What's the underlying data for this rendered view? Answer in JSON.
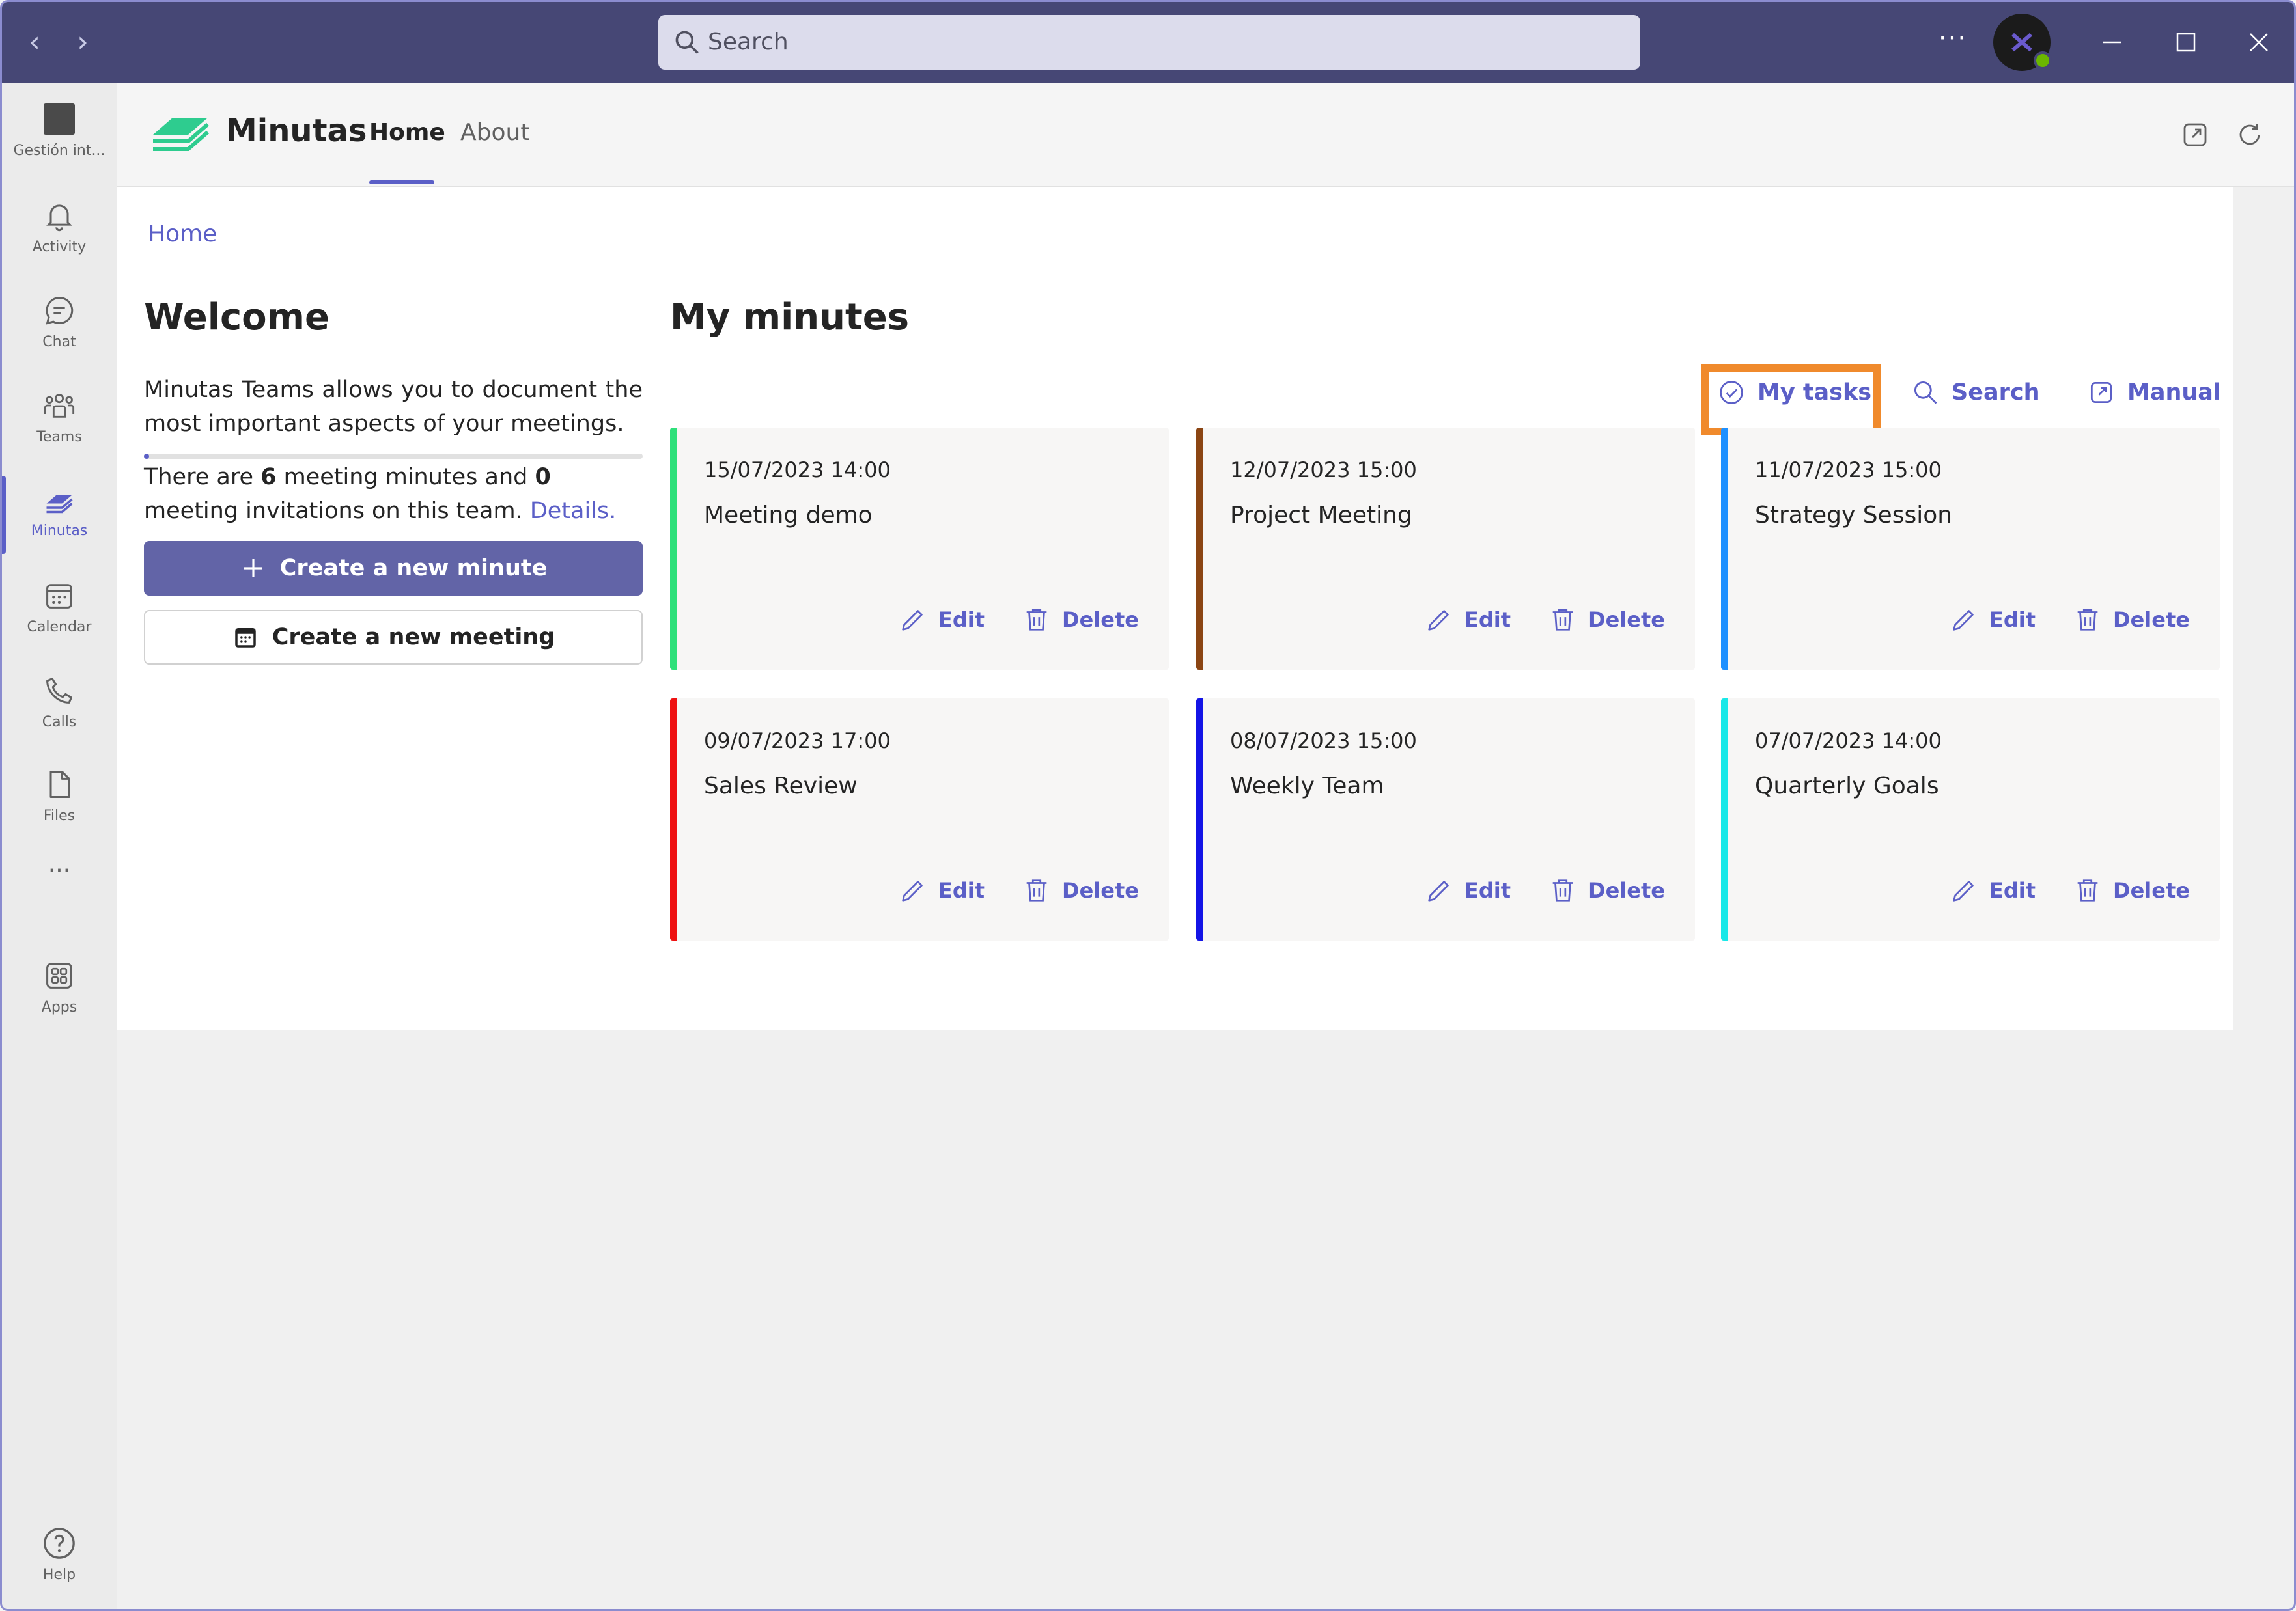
{
  "titlebar": {
    "search_placeholder": "Search",
    "more_label": "···"
  },
  "rail": {
    "items": [
      {
        "label": "Gestión int...",
        "icon": "team-square-icon"
      },
      {
        "label": "Activity",
        "icon": "bell-icon"
      },
      {
        "label": "Chat",
        "icon": "chat-icon"
      },
      {
        "label": "Teams",
        "icon": "teams-icon"
      },
      {
        "label": "Minutas",
        "icon": "minutas-icon"
      },
      {
        "label": "Calendar",
        "icon": "calendar-icon"
      },
      {
        "label": "Calls",
        "icon": "phone-icon"
      },
      {
        "label": "Files",
        "icon": "file-icon"
      },
      {
        "label": "···",
        "icon": "more-icon"
      },
      {
        "label": "Apps",
        "icon": "apps-icon"
      }
    ],
    "help_label": "Help"
  },
  "app": {
    "name": "Minutas",
    "tabs": [
      {
        "label": "Home"
      },
      {
        "label": "About"
      }
    ]
  },
  "content": {
    "breadcrumb": "Home",
    "welcome": {
      "title": "Welcome",
      "description": "Minutas Teams allows you to document the most important aspects of your meetings.",
      "stats_prefix": "There are ",
      "minutes_count": "6",
      "stats_middle": " meeting minutes and ",
      "invitations_count": "0",
      "stats_suffix": " meeting invitations on this team. ",
      "details_link": "Details.",
      "progress_fraction": 0.01,
      "create_minute_label": "Create a new minute",
      "create_meeting_label": "Create a new meeting"
    },
    "minutes": {
      "title": "My minutes",
      "toolbar": {
        "my_tasks": "My tasks",
        "search": "Search",
        "manual": "Manual"
      },
      "cards": [
        {
          "date": "15/07/2023 14:00",
          "title": "Meeting demo",
          "color": "#2ee07a",
          "edit": "Edit",
          "delete": "Delete"
        },
        {
          "date": "12/07/2023 15:00",
          "title": "Project Meeting",
          "color": "#8b4513",
          "edit": "Edit",
          "delete": "Delete"
        },
        {
          "date": "11/07/2023 15:00",
          "title": "Strategy Session",
          "color": "#1e90ff",
          "edit": "Edit",
          "delete": "Delete"
        },
        {
          "date": "09/07/2023 17:00",
          "title": "Sales Review",
          "color": "#ee1111",
          "edit": "Edit",
          "delete": "Delete"
        },
        {
          "date": "08/07/2023 15:00",
          "title": "Weekly Team",
          "color": "#1414e6",
          "edit": "Edit",
          "delete": "Delete"
        },
        {
          "date": "07/07/2023 14:00",
          "title": "Quarterly Goals",
          "color": "#18e8e8",
          "edit": "Edit",
          "delete": "Delete"
        }
      ]
    }
  },
  "colors": {
    "accent": "#5b5fc7",
    "titlebar": "#464775",
    "highlight": "#f08a2c"
  }
}
